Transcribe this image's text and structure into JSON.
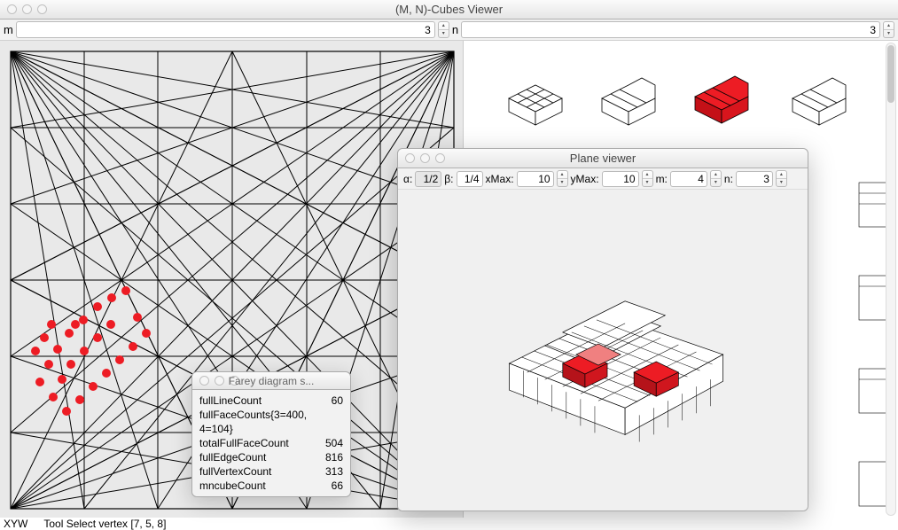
{
  "mainWindow": {
    "title": "(M, N)-Cubes Viewer",
    "m_label": "m",
    "m_value": "3",
    "n_label": "n",
    "n_value": "3"
  },
  "statusbar": {
    "xyw": "XYW",
    "tool": "Tool Select vertex [7, 5, 8]"
  },
  "fareyWindow": {
    "title": "Farey diagram s...",
    "rows": [
      {
        "label": "fullLineCount",
        "value": "60"
      },
      {
        "label": "fullFaceCounts{3=400, 4=104}",
        "value": ""
      },
      {
        "label": "totalFullFaceCount",
        "value": "504"
      },
      {
        "label": "fullEdgeCount",
        "value": "816"
      },
      {
        "label": "fullVertexCount",
        "value": "313"
      },
      {
        "label": "mncubeCount",
        "value": "66"
      }
    ]
  },
  "planeWindow": {
    "title": "Plane viewer",
    "alpha_label": "α:",
    "alpha_value": "1/2",
    "beta_label": "β:",
    "beta_value": "1/4",
    "xmax_label": "xMax:",
    "xmax_value": "10",
    "ymax_label": "yMax:",
    "ymax_value": "10",
    "m_label": "m:",
    "m_value": "4",
    "n_label": "n:",
    "n_value": "3"
  },
  "icons": {
    "up": "▴",
    "down": "▾"
  }
}
